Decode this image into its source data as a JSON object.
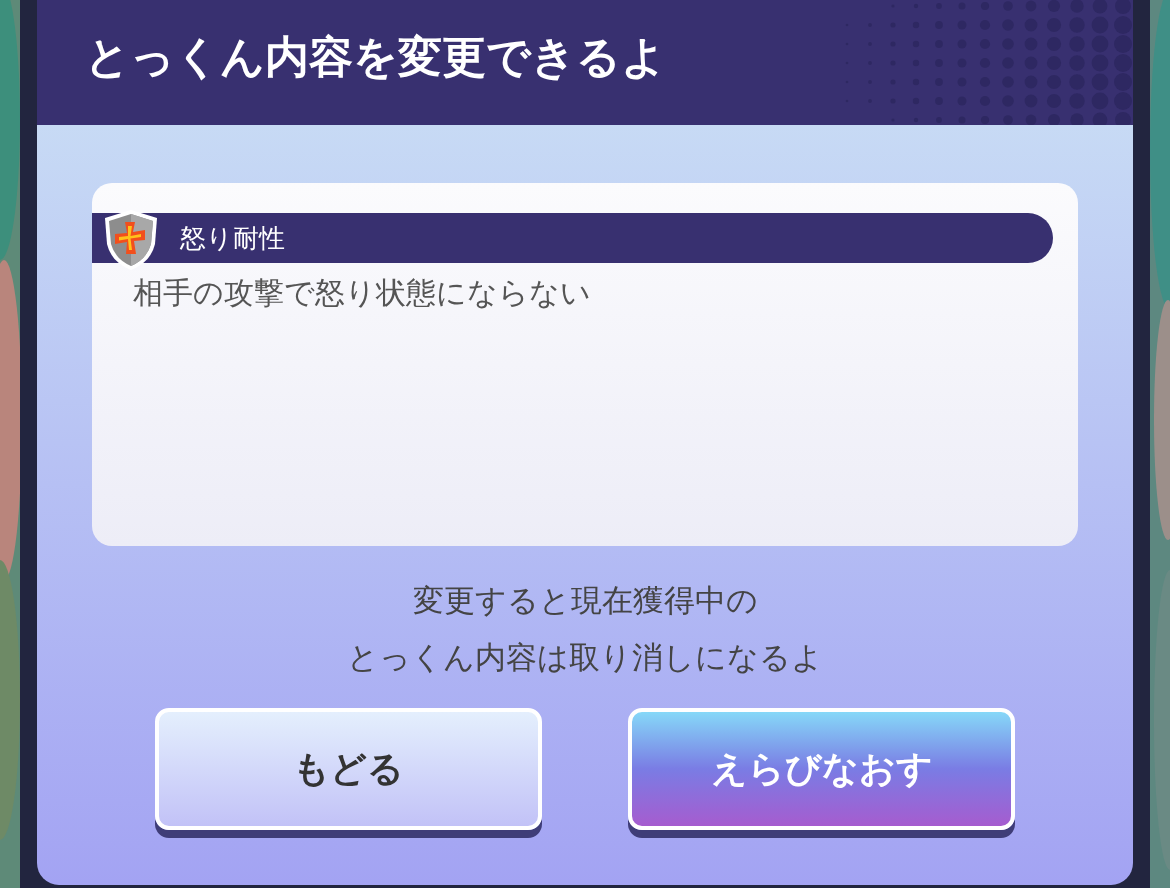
{
  "dialog": {
    "title": "とっくん内容を変更できるよ",
    "skill": {
      "name": "怒り耐性",
      "description": "相手の攻撃で怒り状態にならない"
    },
    "notice": [
      "変更すると現在獲得中の",
      "とっくん内容は取り消しになるよ"
    ],
    "buttons": [
      {
        "label": "もどる",
        "kind": "secondary"
      },
      {
        "label": "えらびなおす",
        "kind": "primary"
      }
    ]
  }
}
